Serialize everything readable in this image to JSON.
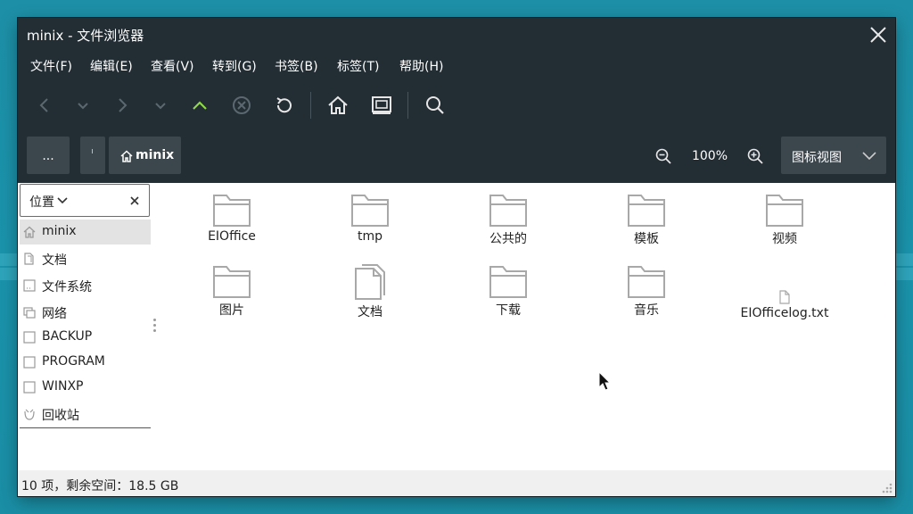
{
  "window": {
    "title": "minix - 文件浏览器"
  },
  "menu": [
    "文件(F)",
    "编辑(E)",
    "查看(V)",
    "转到(G)",
    "书签(B)",
    "标签(T)",
    "帮助(H)"
  ],
  "toolbar": {
    "icons": [
      "back-icon",
      "back-history-icon",
      "forward-icon",
      "forward-history-icon",
      "up-icon",
      "stop-icon",
      "reload-icon",
      "home-icon",
      "computer-icon",
      "search-icon"
    ],
    "up_color": "#8ed94a"
  },
  "location": {
    "parent_label": "...",
    "current_folder": "minix",
    "zoom": "100%",
    "view_mode": "图标视图"
  },
  "sidebar": {
    "header": "位置",
    "items": [
      {
        "label": "minix",
        "icon": "home-icon",
        "selected": true
      },
      {
        "label": "文档",
        "icon": "documents-icon"
      },
      {
        "label": "文件系统",
        "icon": "filesystem-icon"
      },
      {
        "label": "网络",
        "icon": "network-icon"
      },
      {
        "label": "BACKUP",
        "icon": "drive-icon"
      },
      {
        "label": "PROGRAM",
        "icon": "drive-icon"
      },
      {
        "label": "WINXP",
        "icon": "drive-icon"
      },
      {
        "label": "回收站",
        "icon": "trash-icon"
      }
    ]
  },
  "files": [
    {
      "name": "EIOffice",
      "type": "folder"
    },
    {
      "name": "tmp",
      "type": "folder"
    },
    {
      "name": "公共的",
      "type": "folder"
    },
    {
      "name": "模板",
      "type": "folder"
    },
    {
      "name": "视频",
      "type": "folder"
    },
    {
      "name": "图片",
      "type": "folder"
    },
    {
      "name": "文档",
      "type": "documents-folder"
    },
    {
      "name": "下载",
      "type": "folder"
    },
    {
      "name": "音乐",
      "type": "folder"
    },
    {
      "name": "EIOfficelog.txt",
      "type": "text-file"
    }
  ],
  "status": {
    "text": "10 项，剩余空间：18.5 GB"
  }
}
